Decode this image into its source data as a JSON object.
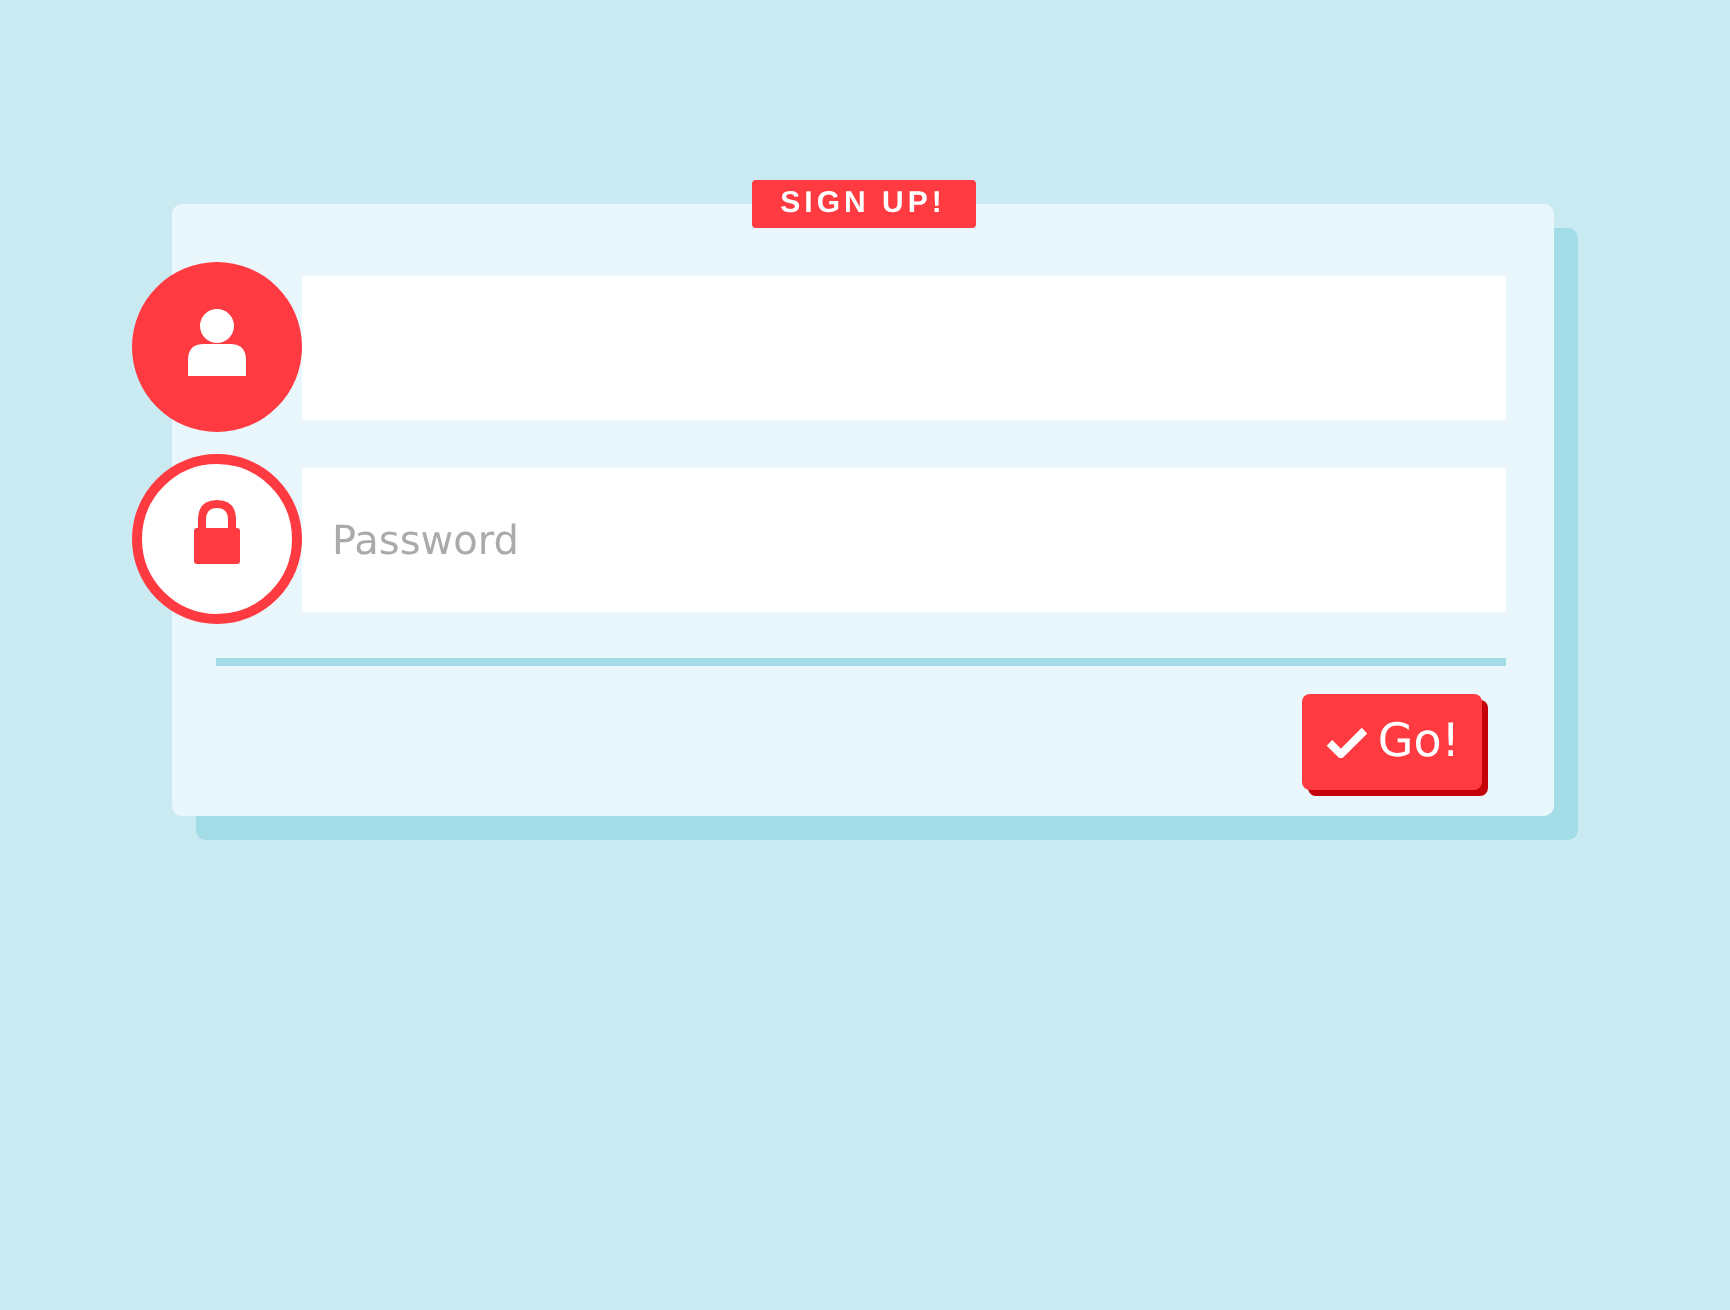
{
  "badge": "SIGN UP!",
  "fields": [
    {
      "kind": "user",
      "focused": true
    },
    {
      "kind": "password",
      "placeholder": "Password",
      "focused": false
    }
  ],
  "submit": {
    "label": "Go!"
  }
}
